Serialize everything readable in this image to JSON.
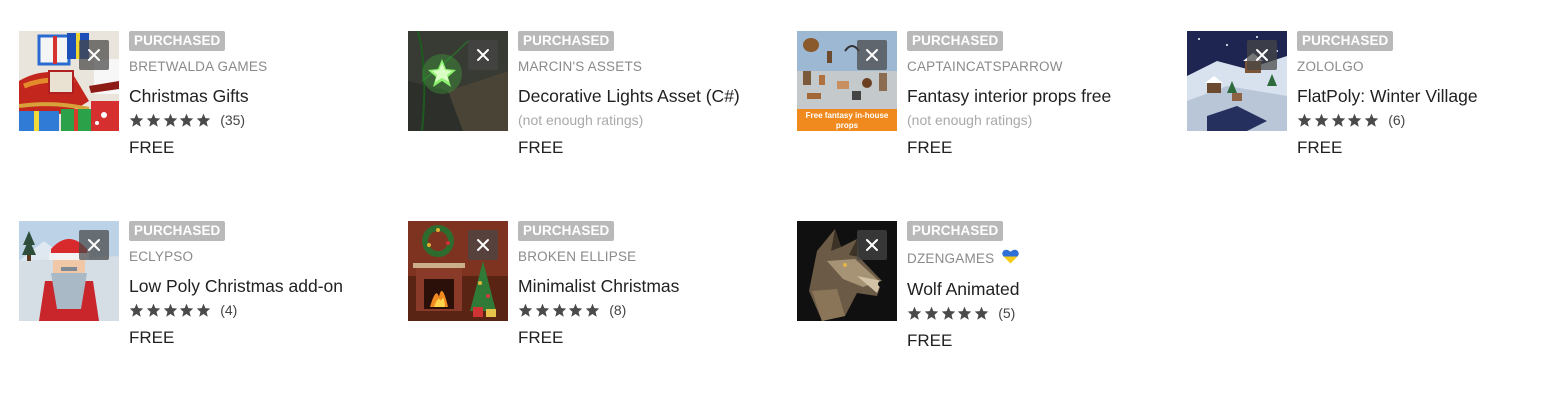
{
  "common": {
    "purchased_label": "PURCHASED",
    "remove_icon": "close-icon",
    "star_icon": "star-icon"
  },
  "items": [
    {
      "publisher": "BRETWALDA GAMES",
      "title": "Christmas Gifts",
      "rating_stars": 5,
      "rating_count": "(35)",
      "price": "FREE"
    },
    {
      "publisher": "MARCIN'S ASSETS",
      "title": "Decorative Lights Asset (C#)",
      "rating_text": "(not enough ratings)",
      "price": "FREE"
    },
    {
      "publisher": "CAPTAINCATSPARROW",
      "title": "Fantasy interior props free",
      "rating_text": "(not enough ratings)",
      "price": "FREE",
      "thumb_caption": "Free fantasy in-house props"
    },
    {
      "publisher": "ZOLOLGO",
      "title": "FlatPoly: Winter Village",
      "rating_stars": 5,
      "rating_count": "(6)",
      "price": "FREE"
    },
    {
      "publisher": "ECLYPSO",
      "title": "Low Poly Christmas add-on",
      "rating_stars": 5,
      "rating_count": "(4)",
      "price": "FREE"
    },
    {
      "publisher": "BROKEN ELLIPSE",
      "title": "Minimalist Christmas",
      "rating_stars": 5,
      "rating_count": "(8)",
      "price": "FREE"
    },
    {
      "publisher": "DZENGAMES",
      "publisher_icon": "ukraine-heart-icon",
      "title": "Wolf Animated",
      "rating_stars": 5,
      "rating_count": "(5)",
      "price": "FREE"
    }
  ],
  "colors": {
    "badge": "#b9b9b9",
    "star": "#4a4a4a",
    "publisher_text": "#8a8a8a",
    "no_rating_text": "#a9a9a9",
    "flag_blue": "#2e6fd8",
    "flag_yellow": "#f5cc1c"
  }
}
